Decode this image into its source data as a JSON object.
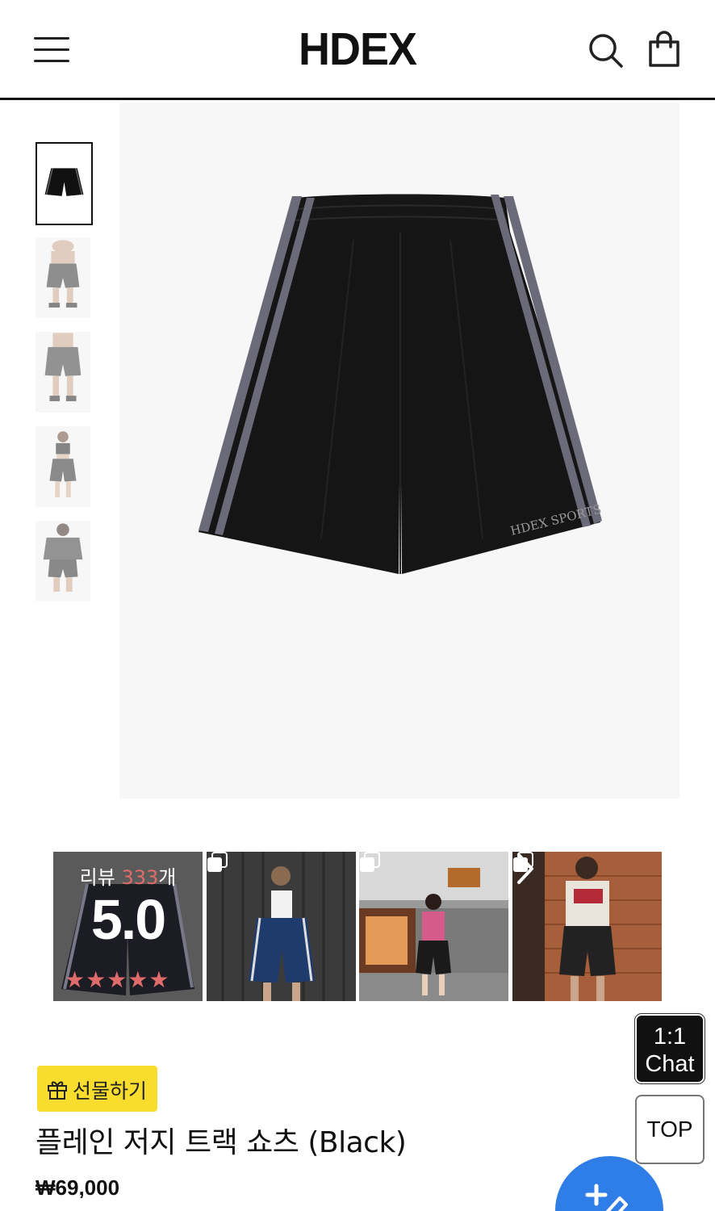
{
  "header": {
    "logo": "HDEX",
    "icons": [
      "menu-icon",
      "search-icon",
      "shopping-bag-icon"
    ]
  },
  "gallery": {
    "thumbnails": [
      {
        "name": "thumb-flat-shorts",
        "active": true
      },
      {
        "name": "thumb-model-front-1",
        "active": false
      },
      {
        "name": "thumb-model-front-2",
        "active": false
      },
      {
        "name": "thumb-model-female",
        "active": false
      },
      {
        "name": "thumb-model-back",
        "active": false
      }
    ],
    "main_image_text": "HDEX SPORTS"
  },
  "reviews": {
    "label_prefix": "리뷰 ",
    "count": "333",
    "label_suffix": "개",
    "score": "5.0",
    "stars": "★★★★★",
    "star_color": "#e06b6b"
  },
  "floating": {
    "chat_label_1": "1:1",
    "chat_label_2": "Chat",
    "top_label": "TOP",
    "fab_color": "#2f7ee8"
  },
  "product": {
    "gift_label": "선물하기",
    "gift_color": "#f8dc2e",
    "title": "플레인 저지 트랙 쇼츠 (Black)",
    "price": "₩69,000"
  }
}
